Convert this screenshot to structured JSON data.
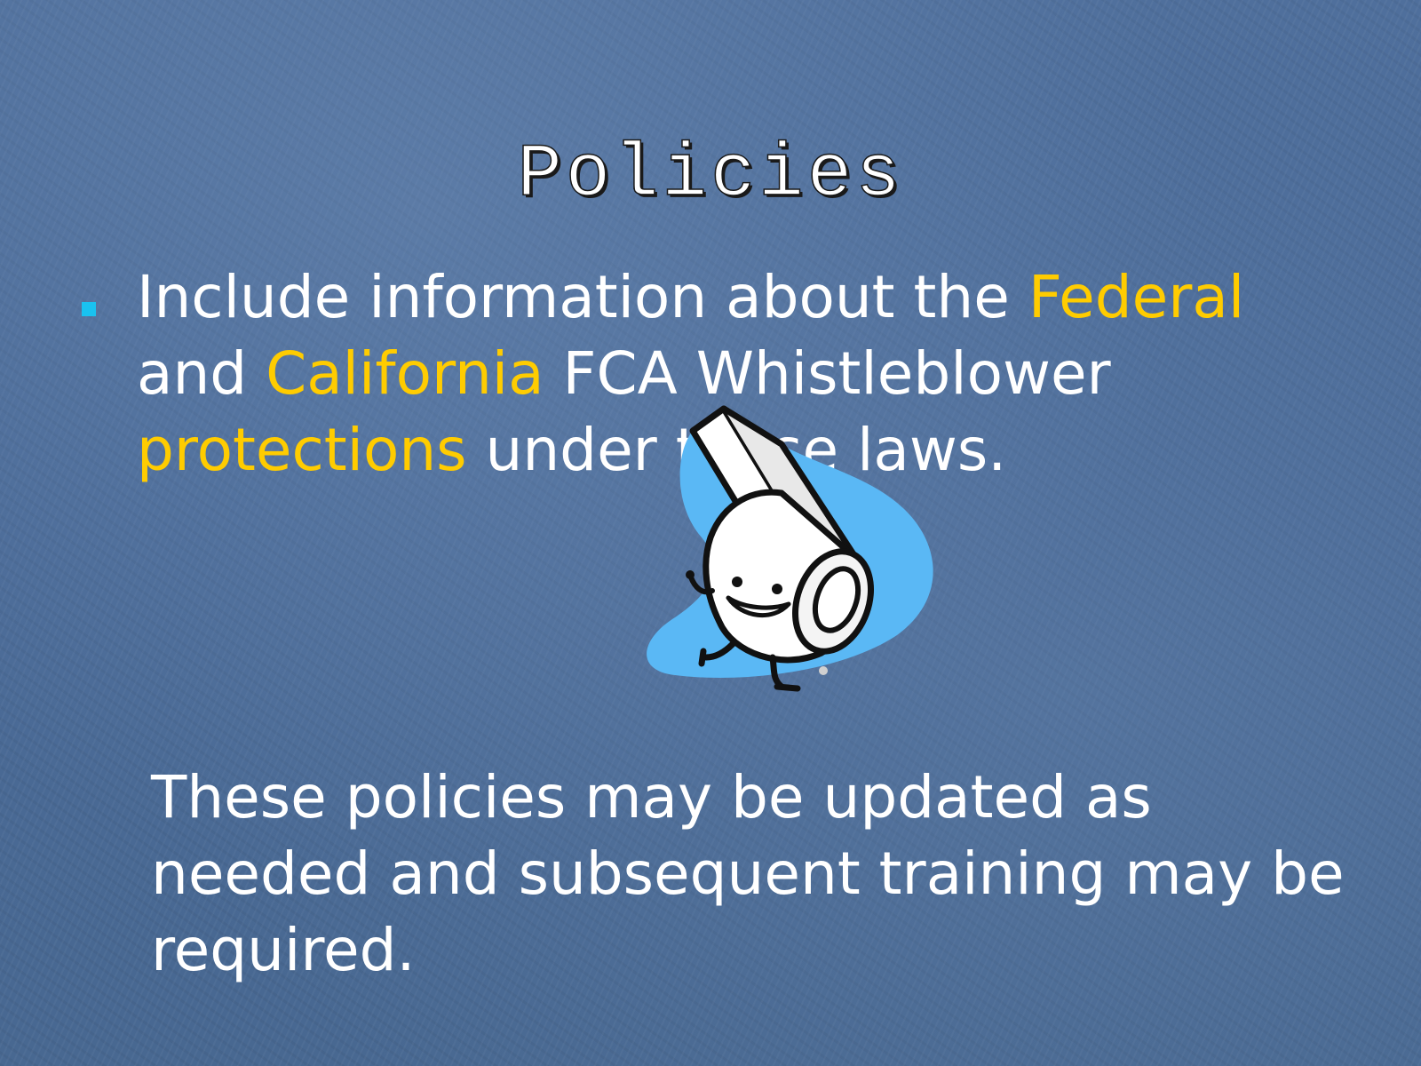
{
  "slide": {
    "title": "Policies",
    "bullet": {
      "part1": "Include information about the ",
      "federal": "Federal",
      "part2": " and ",
      "california": "California",
      "part3": " FCA Whistleblower ",
      "protections": "protections",
      "part4": " under these laws."
    },
    "note": "These policies may be updated as needed and subsequent training may be required.",
    "clipart_icon": "whistle-character-icon",
    "colors": {
      "background": "#4a6c98",
      "highlight": "#ffcc00",
      "bullet_marker": "#19c2f0",
      "text": "#ffffff"
    }
  }
}
